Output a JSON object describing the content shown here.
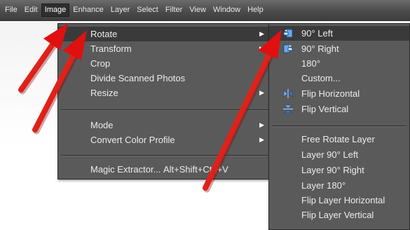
{
  "menubar": {
    "items": [
      "File",
      "Edit",
      "Image",
      "Enhance",
      "Layer",
      "Select",
      "Filter",
      "View",
      "Window",
      "Help"
    ]
  },
  "image_menu": {
    "rotate": "Rotate",
    "transform": "Transform",
    "crop": "Crop",
    "divide_scanned": "Divide Scanned Photos",
    "resize": "Resize",
    "mode": "Mode",
    "convert_profile": "Convert Color Profile",
    "magic_extractor": "Magic Extractor...",
    "magic_extractor_shortcut": "Alt+Shift+Ctrl+V"
  },
  "rotate_menu": {
    "left90": "90° Left",
    "right90": "90° Right",
    "r180": "180°",
    "custom": "Custom...",
    "flip_h": "Flip Horizontal",
    "flip_v": "Flip Vertical",
    "free_rotate_layer": "Free Rotate Layer",
    "layer_left90": "Layer 90° Left",
    "layer_right90": "Layer 90° Right",
    "layer_180": "Layer 180°",
    "flip_layer_h": "Flip Layer Horizontal",
    "flip_layer_v": "Flip Layer Vertical"
  },
  "icons": {
    "rotate_left": "rotate-left-icon",
    "rotate_right": "rotate-right-icon",
    "flip_horizontal": "flip-horizontal-icon",
    "flip_vertical": "flip-vertical-icon",
    "submenu_arrow": "submenu-arrow-icon",
    "annotation_arrow": "red-arrow-annotation"
  },
  "colors": {
    "menu_bg": "#5a5a5a",
    "highlight": "#3a3a3a",
    "annotation": "#e01010"
  }
}
